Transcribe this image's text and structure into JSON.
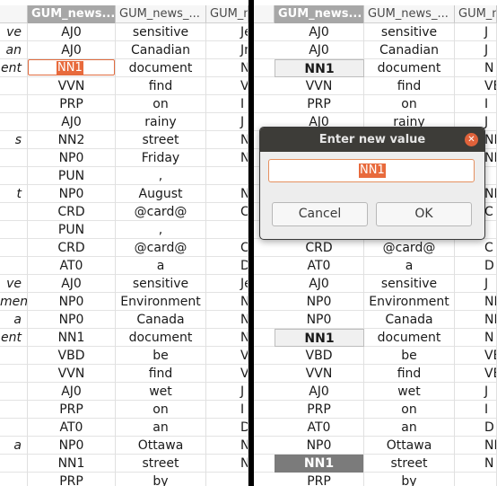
{
  "left_pane": {
    "headers": [
      {
        "text": "",
        "selected": false
      },
      {
        "text": "GUM_news...",
        "selected": true
      },
      {
        "text": "GUM_news_...",
        "selected": false
      },
      {
        "text": "GUM_n",
        "selected": false
      }
    ],
    "rows": [
      [
        "ve",
        "AJ0",
        "sensitive",
        "Je"
      ],
      [
        "an",
        "AJ0",
        "Canadian",
        "Jn"
      ],
      [
        "ent",
        "NN1",
        "document",
        "Nt"
      ],
      [
        "",
        "VVN",
        "find",
        "VE"
      ],
      [
        "",
        "PRP",
        "on",
        "I"
      ],
      [
        "",
        "AJ0",
        "rainy",
        "J"
      ],
      [
        "s",
        "NN2",
        "street",
        "NN"
      ],
      [
        "",
        "NP0",
        "Friday",
        "NN"
      ],
      [
        "",
        "PUN",
        ",",
        ""
      ],
      [
        "t",
        "NP0",
        "August",
        "NI"
      ],
      [
        "",
        "CRD",
        "@card@",
        "C"
      ],
      [
        "",
        "PUN",
        ",",
        ""
      ],
      [
        "",
        "CRD",
        "@card@",
        "C"
      ],
      [
        "",
        "AT0",
        "a",
        "D"
      ],
      [
        "ve",
        "AJ0",
        "sensitive",
        "Je"
      ],
      [
        "ment",
        "NP0",
        "Environment",
        "Nt"
      ],
      [
        "a",
        "NP0",
        "Canada",
        "NI"
      ],
      [
        "ent",
        "NN1",
        "document",
        "Nt"
      ],
      [
        "",
        "VBD",
        "be",
        "VE"
      ],
      [
        "",
        "VVN",
        "find",
        "VE"
      ],
      [
        "",
        "AJ0",
        "wet",
        "J"
      ],
      [
        "",
        "PRP",
        "on",
        "I"
      ],
      [
        "",
        "AT0",
        "an",
        "D"
      ],
      [
        "a",
        "NP0",
        "Ottawa",
        "NI"
      ],
      [
        "",
        "NN1",
        "street",
        "N"
      ],
      [
        "",
        "PRP",
        "by",
        ""
      ]
    ],
    "edit_value": "NN1"
  },
  "right_pane": {
    "headers": [
      {
        "text": "GUM_news...",
        "selected": true
      },
      {
        "text": "GUM_news_...",
        "selected": false
      },
      {
        "text": "GUM_ne",
        "selected": false
      }
    ],
    "rows": [
      [
        "AJ0",
        "sensitive",
        "J"
      ],
      [
        "AJ0",
        "Canadian",
        "J"
      ],
      [
        "NN1",
        "document",
        "N"
      ],
      [
        "VVN",
        "find",
        "VE"
      ],
      [
        "PRP",
        "on",
        "I"
      ],
      [
        "AJ0",
        "rainy",
        "J"
      ],
      [
        "",
        "",
        "NI"
      ],
      [
        "",
        "",
        "NI"
      ],
      [
        "",
        "",
        ""
      ],
      [
        "",
        "",
        "NI"
      ],
      [
        "",
        "",
        "C"
      ],
      [
        "",
        "",
        ""
      ],
      [
        "CRD",
        "@card@",
        "C"
      ],
      [
        "AT0",
        "a",
        "D"
      ],
      [
        "AJ0",
        "sensitive",
        "J"
      ],
      [
        "NP0",
        "Environment",
        "NI"
      ],
      [
        "NP0",
        "Canada",
        "NI"
      ],
      [
        "NN1",
        "document",
        "N"
      ],
      [
        "VBD",
        "be",
        "VE"
      ],
      [
        "VVN",
        "find",
        "VE"
      ],
      [
        "AJ0",
        "wet",
        "J"
      ],
      [
        "PRP",
        "on",
        "I"
      ],
      [
        "AT0",
        "an",
        "D"
      ],
      [
        "NP0",
        "Ottawa",
        "NI"
      ],
      [
        "NN1",
        "street",
        "N"
      ],
      [
        "PRP",
        "by",
        ""
      ]
    ],
    "bold_rows": [
      2,
      17
    ],
    "dark_rows": [
      24
    ]
  },
  "dialog": {
    "title": "Enter new value",
    "close_glyph": "✕",
    "input_value": "NN1",
    "cancel_label": "Cancel",
    "ok_label": "OK"
  }
}
